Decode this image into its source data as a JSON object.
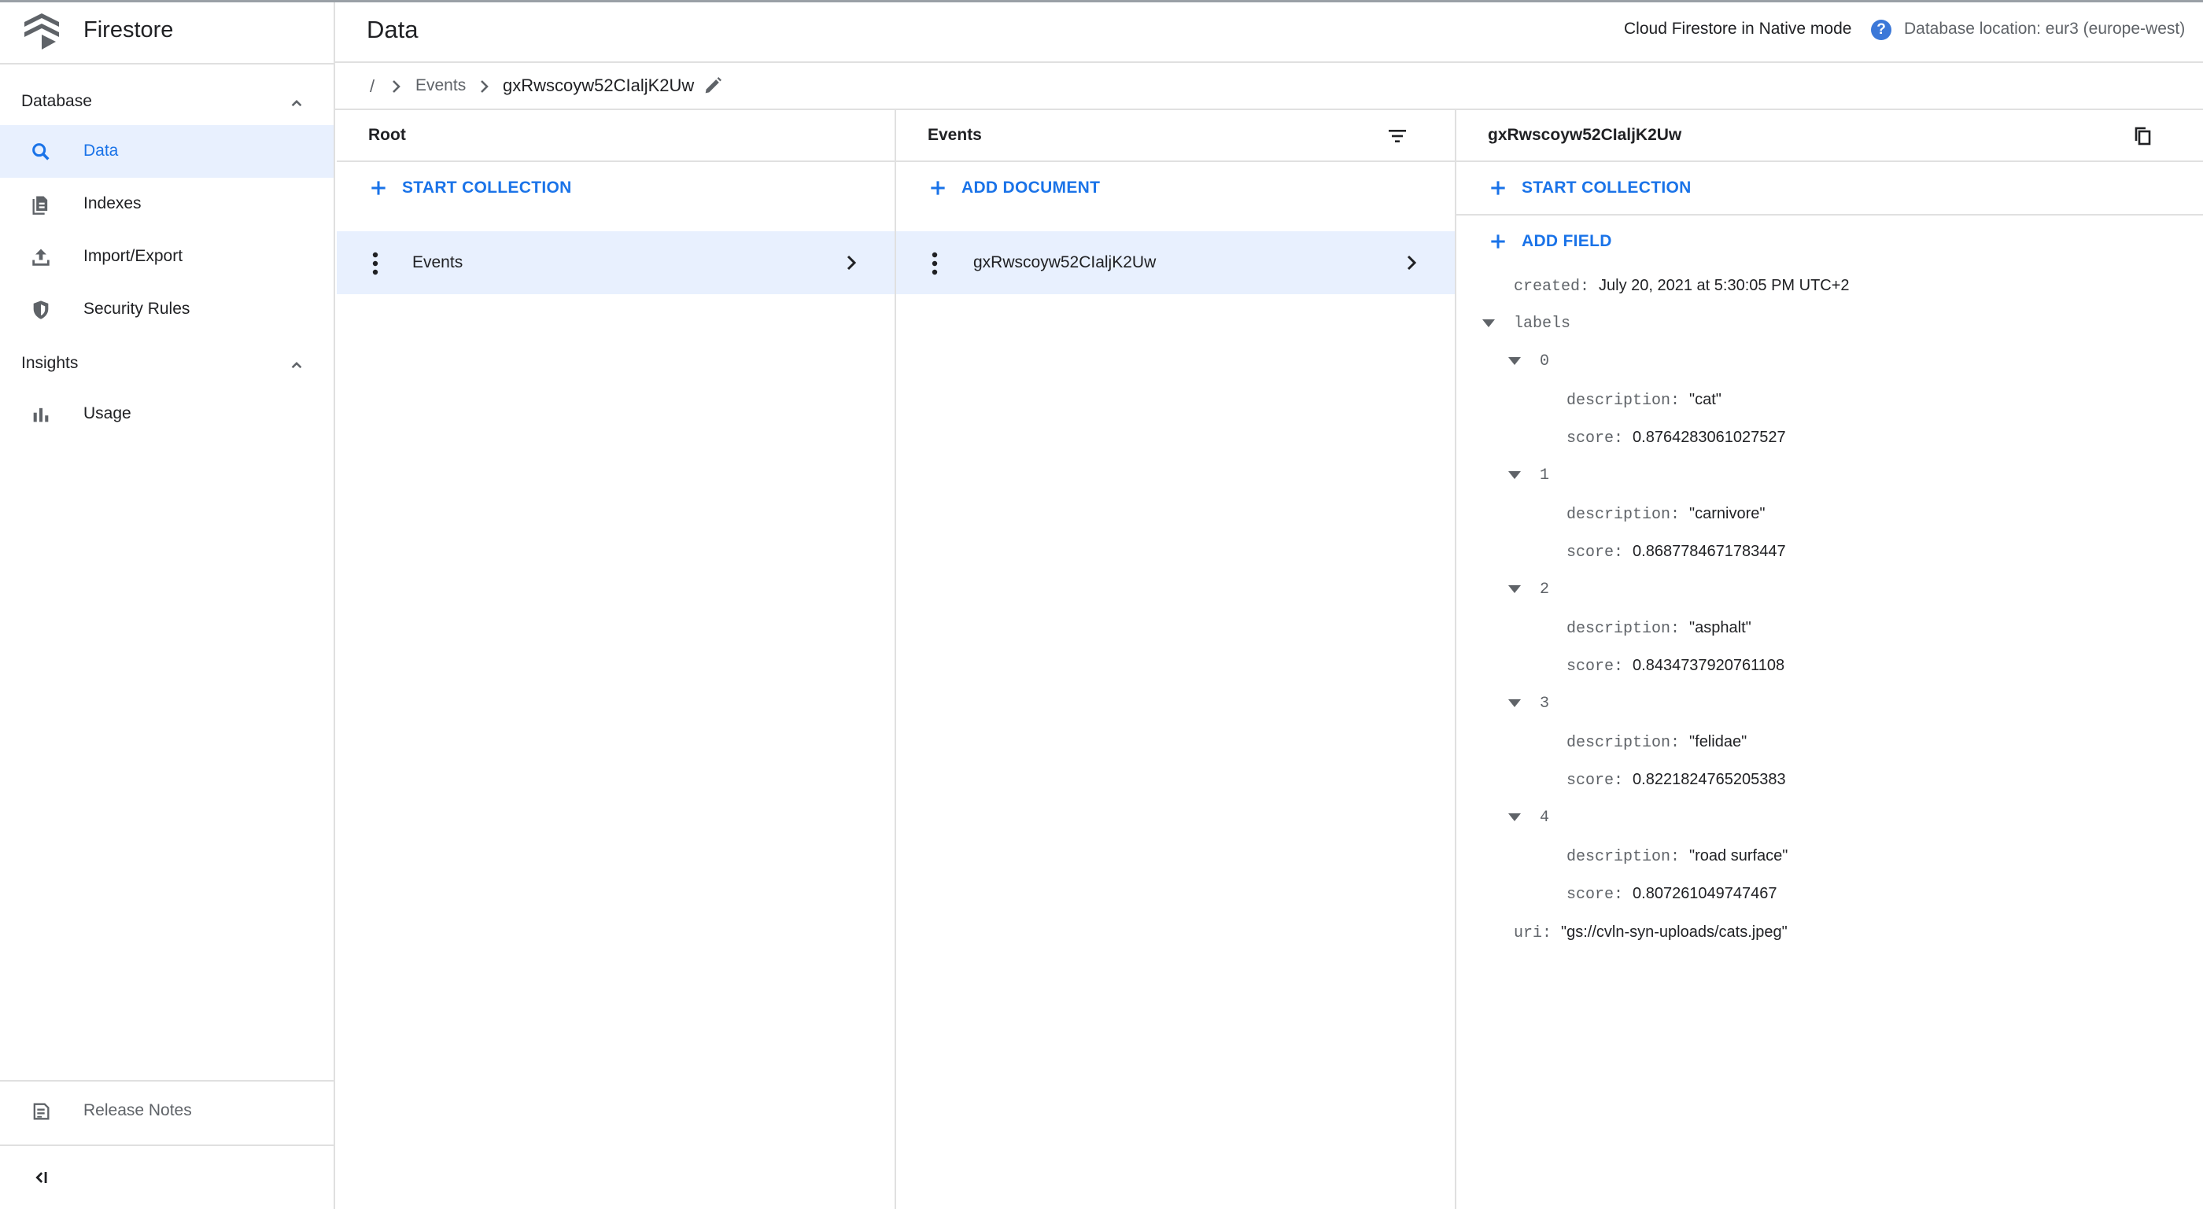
{
  "app": {
    "name": "Firestore"
  },
  "sidebar": {
    "sections": [
      {
        "label": "Database",
        "items": [
          "Data",
          "Indexes",
          "Import/Export",
          "Security Rules"
        ]
      },
      {
        "label": "Insights",
        "items": [
          "Usage"
        ]
      }
    ],
    "active_item": "Data",
    "release_notes": "Release Notes",
    "collapse_label": "<I"
  },
  "header": {
    "title": "Data",
    "mode": "Cloud Firestore in Native mode",
    "help": "?",
    "location": "Database location: eur3 (europe-west)"
  },
  "breadcrumb": {
    "root": "/",
    "items": [
      "Events",
      "gxRwscoyw52CIaljK2Uw"
    ]
  },
  "columns": {
    "root": {
      "title": "Root",
      "action": "START COLLECTION",
      "items": [
        "Events"
      ]
    },
    "collection": {
      "title": "Events",
      "action": "ADD DOCUMENT",
      "items": [
        "gxRwscoyw52CIaljK2Uw"
      ]
    },
    "document": {
      "title": "gxRwscoyw52CIaljK2Uw",
      "start_collection": "START COLLECTION",
      "add_field": "ADD FIELD",
      "created_key": "created:",
      "created_value": "July 20, 2021 at 5:30:05 PM UTC+2",
      "labels_key": "labels",
      "labels": [
        {
          "index": "0",
          "description_key": "description:",
          "description": "\"cat\"",
          "score_key": "score:",
          "score": "0.8764283061027527"
        },
        {
          "index": "1",
          "description_key": "description:",
          "description": "\"carnivore\"",
          "score_key": "score:",
          "score": "0.8687784671783447"
        },
        {
          "index": "2",
          "description_key": "description:",
          "description": "\"asphalt\"",
          "score_key": "score:",
          "score": "0.8434737920761108"
        },
        {
          "index": "3",
          "description_key": "description:",
          "description": "\"felidae\"",
          "score_key": "score:",
          "score": "0.8221824765205383"
        },
        {
          "index": "4",
          "description_key": "description:",
          "description": "\"road surface\"",
          "score_key": "score:",
          "score": "0.807261049747467"
        }
      ],
      "uri_key": "uri:",
      "uri_value": "\"gs://cvln-syn-uploads/cats.jpeg\""
    }
  },
  "colors": {
    "accent": "#1a73e8",
    "active_bg": "#e8f0fe",
    "divider": "#e0e0e0",
    "icon": "#5f6368"
  },
  "icons": [
    "firestore-logo",
    "search-icon",
    "indexes-icon",
    "import-export-icon",
    "shield-icon",
    "bar-chart-icon",
    "release-notes-icon",
    "collapse-icon",
    "chevron-up-icon",
    "chevron-right-icon",
    "edit-icon",
    "filter-icon",
    "copy-icon",
    "plus-icon",
    "more-vert-icon",
    "triangle-down-icon",
    "help-icon"
  ]
}
